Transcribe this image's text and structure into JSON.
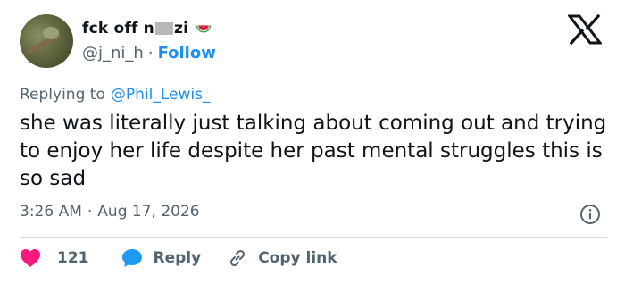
{
  "user": {
    "display_name_start": "fck off n",
    "display_name_end": "zi",
    "handle": "@j_ni_h",
    "separator": "·",
    "follow_label": "Follow"
  },
  "reply": {
    "prefix": "Replying to",
    "mention": "@Phil_Lewis_"
  },
  "tweet": {
    "text": "she was literally just talking about coming out and trying to enjoy her life despite her past mental struggles this is so sad",
    "time": "3:26 AM",
    "separator": "·",
    "date": "Aug 17, 2026"
  },
  "actions": {
    "like_count": "121",
    "reply_label": "Reply",
    "copy_label": "Copy link"
  },
  "colors": {
    "like": "#f91880",
    "reply": "#1d9bf0",
    "link": "#1d8ff0",
    "muted": "#536471"
  },
  "icons": [
    "watermelon-icon",
    "x-logo-icon",
    "info-icon",
    "heart-icon",
    "reply-bubble-icon",
    "link-icon"
  ]
}
